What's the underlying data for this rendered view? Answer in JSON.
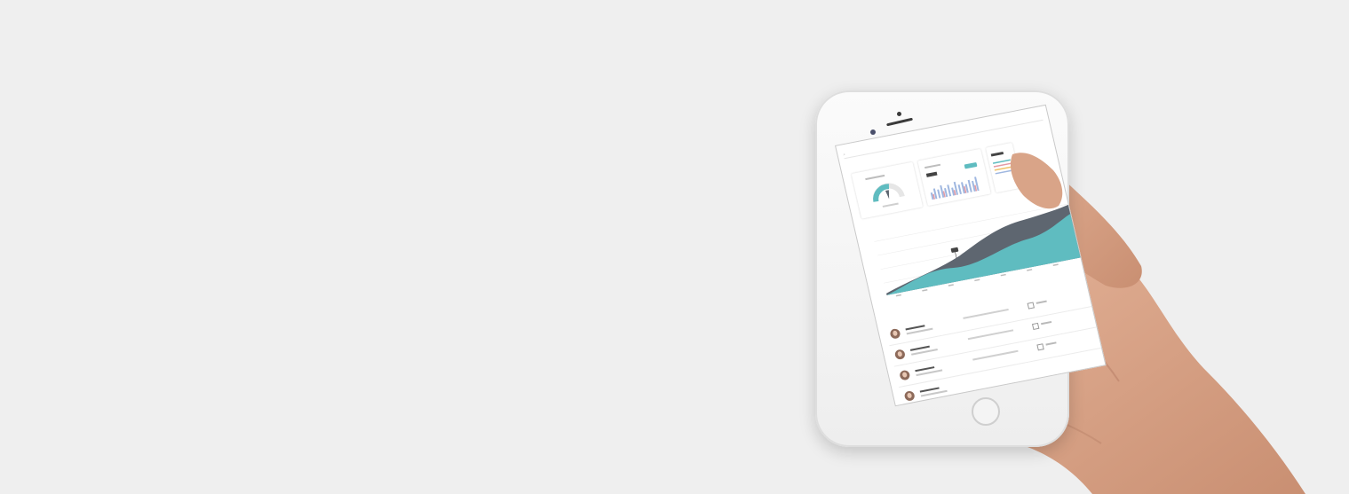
{
  "scene": {
    "background": "#efefef",
    "skin_color": "#d9a488",
    "skin_shadow": "#b9826a",
    "phone_color": "#f4f4f4"
  },
  "app": {
    "colors": {
      "teal": "#5fbcc0",
      "slate": "#5e6670",
      "grid": "#eeeeee"
    },
    "icons": [
      "search-icon",
      "gauge-icon",
      "avatar-icon",
      "calendar-icon"
    ]
  }
}
